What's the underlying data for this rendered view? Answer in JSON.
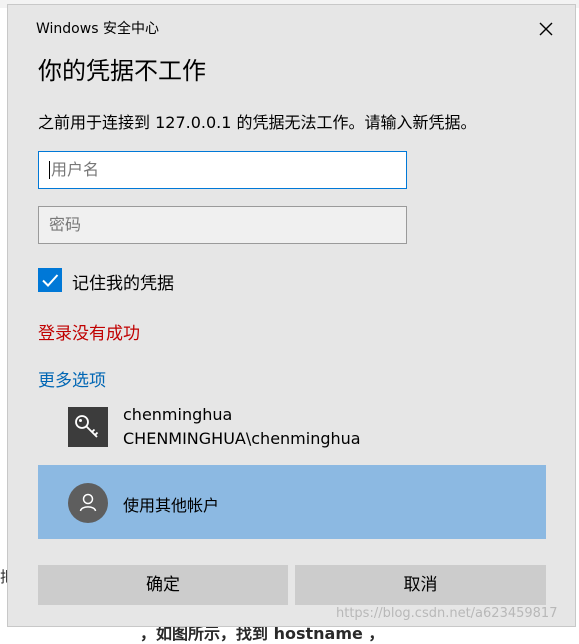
{
  "window": {
    "title": "Windows 安全中心"
  },
  "heading": "你的凭据不工作",
  "message": "之前用于连接到 127.0.0.1 的凭据无法工作。请输入新凭据。",
  "username": {
    "placeholder": "用户名",
    "value": ""
  },
  "password": {
    "placeholder": "密码",
    "value": ""
  },
  "remember": {
    "label": "记住我的凭据",
    "checked": true
  },
  "error_text": "登录没有成功",
  "more_options": "更多选项",
  "accounts": [
    {
      "name": "chenminghua",
      "domain_user": "CHENMINGHUA\\chenminghua",
      "icon": "key-icon"
    }
  ],
  "other_account": {
    "label": "使用其他帐户",
    "icon": "person-icon"
  },
  "buttons": {
    "ok": "确定",
    "cancel": "取消"
  },
  "background": {
    "left_fragment": "把",
    "bottom_fragment": "，如图所示，找到 hostname ，"
  },
  "watermark": "https://blog.csdn.net/a623459817",
  "colors": {
    "accent": "#0078d7",
    "error": "#c00000",
    "link": "#0066b4",
    "selected_item": "#8cb9e2",
    "dialog_bg": "#e6e6e6",
    "button_bg": "#cccccc"
  }
}
